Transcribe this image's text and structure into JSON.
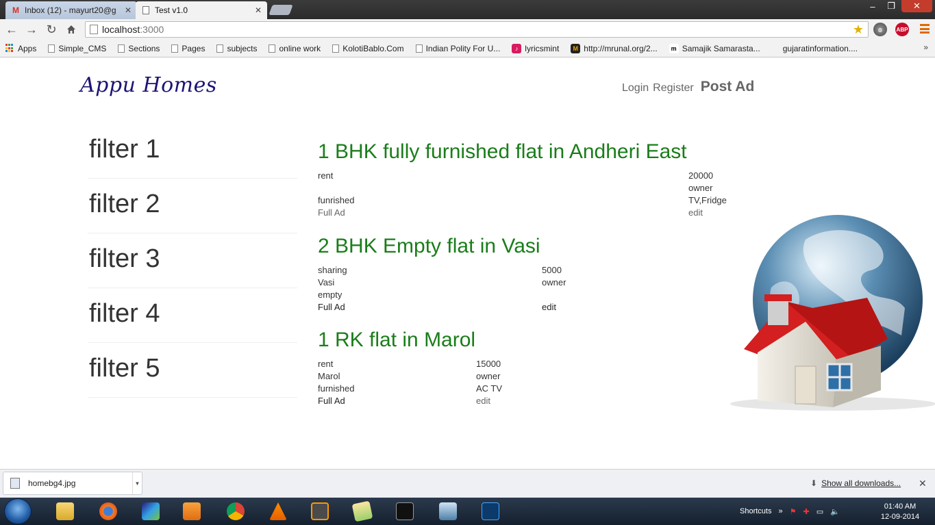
{
  "browser": {
    "tabs": [
      {
        "label": "Inbox (12) - mayurt20@g",
        "icon": "gmail-icon"
      },
      {
        "label": "Test v1.0",
        "icon": "page-icon"
      }
    ],
    "window_buttons": {
      "minimize": "–",
      "maximize": "❐",
      "close": "✕"
    },
    "address": {
      "host": "localhost",
      "port": ":3000"
    },
    "bookmarks": [
      {
        "label": "Apps",
        "icon": "apps-grid-icon"
      },
      {
        "label": "Simple_CMS",
        "icon": "page-icon"
      },
      {
        "label": "Sections",
        "icon": "page-icon"
      },
      {
        "label": "Pages",
        "icon": "page-icon"
      },
      {
        "label": "subjects",
        "icon": "page-icon"
      },
      {
        "label": "online work",
        "icon": "page-icon"
      },
      {
        "label": "KolotiBablo.Com",
        "icon": "page-icon"
      },
      {
        "label": "Indian Polity For U...",
        "icon": "page-icon"
      },
      {
        "label": "lyricsmint",
        "icon": "lyricsmint-icon"
      },
      {
        "label": "http://mrunal.org/2...",
        "icon": "mrunal-icon"
      },
      {
        "label": "Samajik Samarasta...",
        "icon": "samajik-icon"
      },
      {
        "label": "gujaratinformation....",
        "icon": "none"
      }
    ],
    "bookmarks_more": "»"
  },
  "site": {
    "logo": "Appu Homes",
    "nav": {
      "login": "Login",
      "register": "Register",
      "post_ad": "Post Ad"
    },
    "filters": [
      "filter 1",
      "filter 2",
      "filter 3",
      "filter 4",
      "filter 5"
    ],
    "ads": [
      {
        "title": "1 BHK fully furnished flat in Andheri East",
        "type": "rent",
        "price": "20000",
        "location": "",
        "posted_by": "owner",
        "furnishing": "funrished",
        "amenities": "TV,Fridge",
        "full_ad": "Full Ad",
        "edit": "edit"
      },
      {
        "title": "2 BHK Empty flat in Vasi",
        "type": "sharing",
        "price": "5000",
        "location": "Vasi",
        "posted_by": "owner",
        "furnishing": "empty",
        "amenities": "",
        "full_ad": "Full Ad",
        "edit": "edit"
      },
      {
        "title": "1 RK flat in Marol",
        "type": "rent",
        "price": "15000",
        "location": "Marol",
        "posted_by": "owner",
        "furnishing": "furnished",
        "amenities": "AC TV",
        "full_ad": "Full Ad",
        "edit": "edit"
      }
    ]
  },
  "downloads": {
    "file": "homebg4.jpg",
    "show_all": "Show all downloads...",
    "close": "✕"
  },
  "taskbar": {
    "apps": [
      "explorer",
      "firefox",
      "winamp",
      "media-player",
      "chrome",
      "vlc",
      "sublime-text",
      "folder",
      "cmd",
      "network",
      "photoshop"
    ],
    "tray_label": "Shortcuts",
    "tray_more": "»",
    "time": "01:40 AM",
    "date": "12-09-2014"
  },
  "colors": {
    "ad_title": "#1a7d1a",
    "logo": "#1d1474",
    "gmail": "#d93025",
    "abp": "#c70d2c",
    "chrome_menu": "#e06a00"
  }
}
